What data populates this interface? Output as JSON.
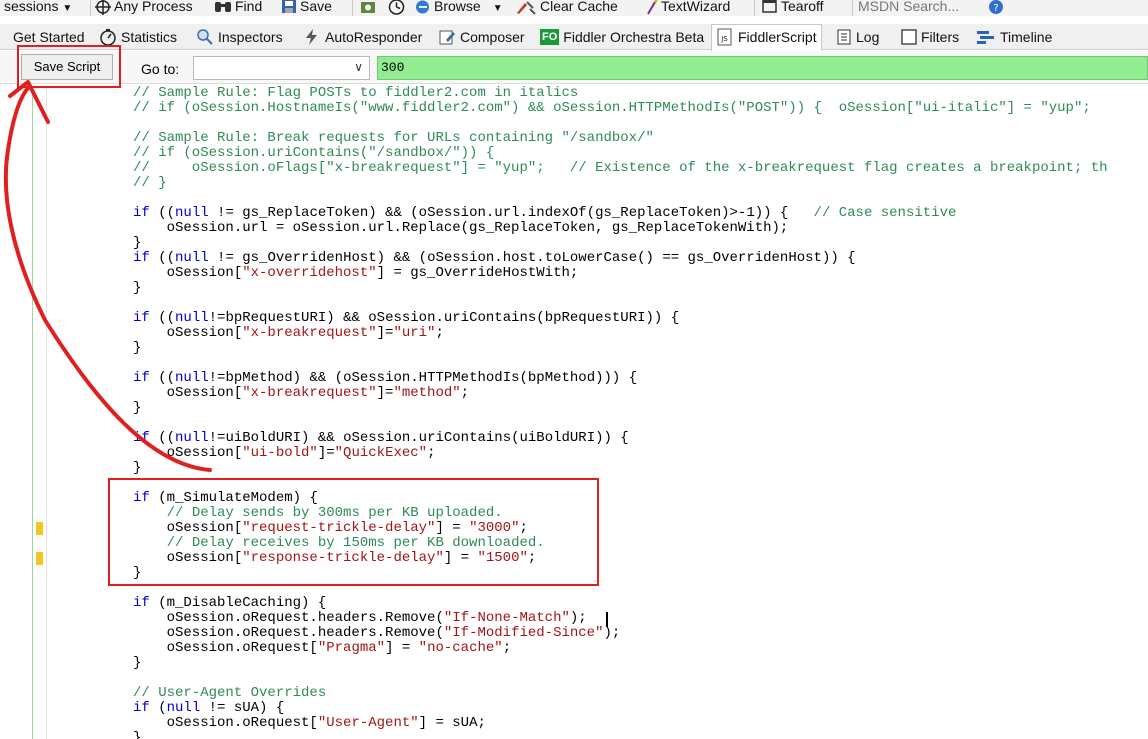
{
  "toolbar": {
    "sessions_label": "sessions",
    "any_process_label": "Any Process",
    "find_label": "Find",
    "save_label": "Save",
    "browse_label": "Browse",
    "clear_cache_label": "Clear Cache",
    "textwizard_label": "TextWizard",
    "tearoff_label": "Tearoff",
    "search_placeholder": "MSDN Search..."
  },
  "tabs": [
    {
      "label": "Get Started"
    },
    {
      "label": "Statistics"
    },
    {
      "label": "Inspectors"
    },
    {
      "label": "AutoResponder"
    },
    {
      "label": "Composer"
    },
    {
      "label": "Fiddler Orchestra Beta",
      "badge": "FO"
    },
    {
      "label": "FiddlerScript",
      "active": true
    },
    {
      "label": "Log"
    },
    {
      "label": "Filters"
    },
    {
      "label": "Timeline"
    }
  ],
  "scriptbar": {
    "save_script_label": "Save Script",
    "goto_label": "Go to:",
    "goto_value": "",
    "quickexec_value": "300"
  },
  "code_lines": [
    "// Sample Rule: Flag POSTs to fiddler2.com in italics",
    "// if (oSession.HostnameIs(\"www.fiddler2.com\") && oSession.HTTPMethodIs(\"POST\")) {  oSession[\"ui-italic\"] = \"yup\";",
    "",
    "// Sample Rule: Break requests for URLs containing \"/sandbox/\"",
    "// if (oSession.uriContains(\"/sandbox/\")) {",
    "//     oSession.oFlags[\"x-breakrequest\"] = \"yup\";   // Existence of the x-breakrequest flag creates a breakpoint; th",
    "// }",
    "",
    "if ((null != gs_ReplaceToken) && (oSession.url.indexOf(gs_ReplaceToken)>-1)) {   // Case sensitive",
    "    oSession.url = oSession.url.Replace(gs_ReplaceToken, gs_ReplaceTokenWith);",
    "}",
    "if ((null != gs_OverridenHost) && (oSession.host.toLowerCase() == gs_OverridenHost)) {",
    "    oSession[\"x-overridehost\"] = gs_OverrideHostWith;",
    "}",
    "",
    "if ((null!=bpRequestURI) && oSession.uriContains(bpRequestURI)) {",
    "    oSession[\"x-breakrequest\"]=\"uri\";",
    "}",
    "",
    "if ((null!=bpMethod) && (oSession.HTTPMethodIs(bpMethod))) {",
    "    oSession[\"x-breakrequest\"]=\"method\";",
    "}",
    "",
    "if ((null!=uiBoldURI) && oSession.uriContains(uiBoldURI)) {",
    "    oSession[\"ui-bold\"]=\"QuickExec\";",
    "}",
    "",
    "if (m_SimulateModem) {",
    "    // Delay sends by 300ms per KB uploaded.",
    "    oSession[\"request-trickle-delay\"] = \"3000\";",
    "    // Delay receives by 150ms per KB downloaded.",
    "    oSession[\"response-trickle-delay\"] = \"1500\";",
    "}",
    "",
    "if (m_DisableCaching) {",
    "    oSession.oRequest.headers.Remove(\"If-None-Match\");",
    "    oSession.oRequest.headers.Remove(\"If-Modified-Since\");",
    "    oSession.oRequest[\"Pragma\"] = \"no-cache\";",
    "}",
    "",
    "// User-Agent Overrides",
    "if (null != sUA) {",
    "    oSession.oRequest[\"User-Agent\"] = sUA;",
    "}"
  ],
  "colors": {
    "comment": "#2e8b57",
    "keyword": "#0000cc",
    "string": "#a31515",
    "quickexec_bg": "#90ee90",
    "annotation": "#e02020",
    "marker": "#f3c623"
  }
}
